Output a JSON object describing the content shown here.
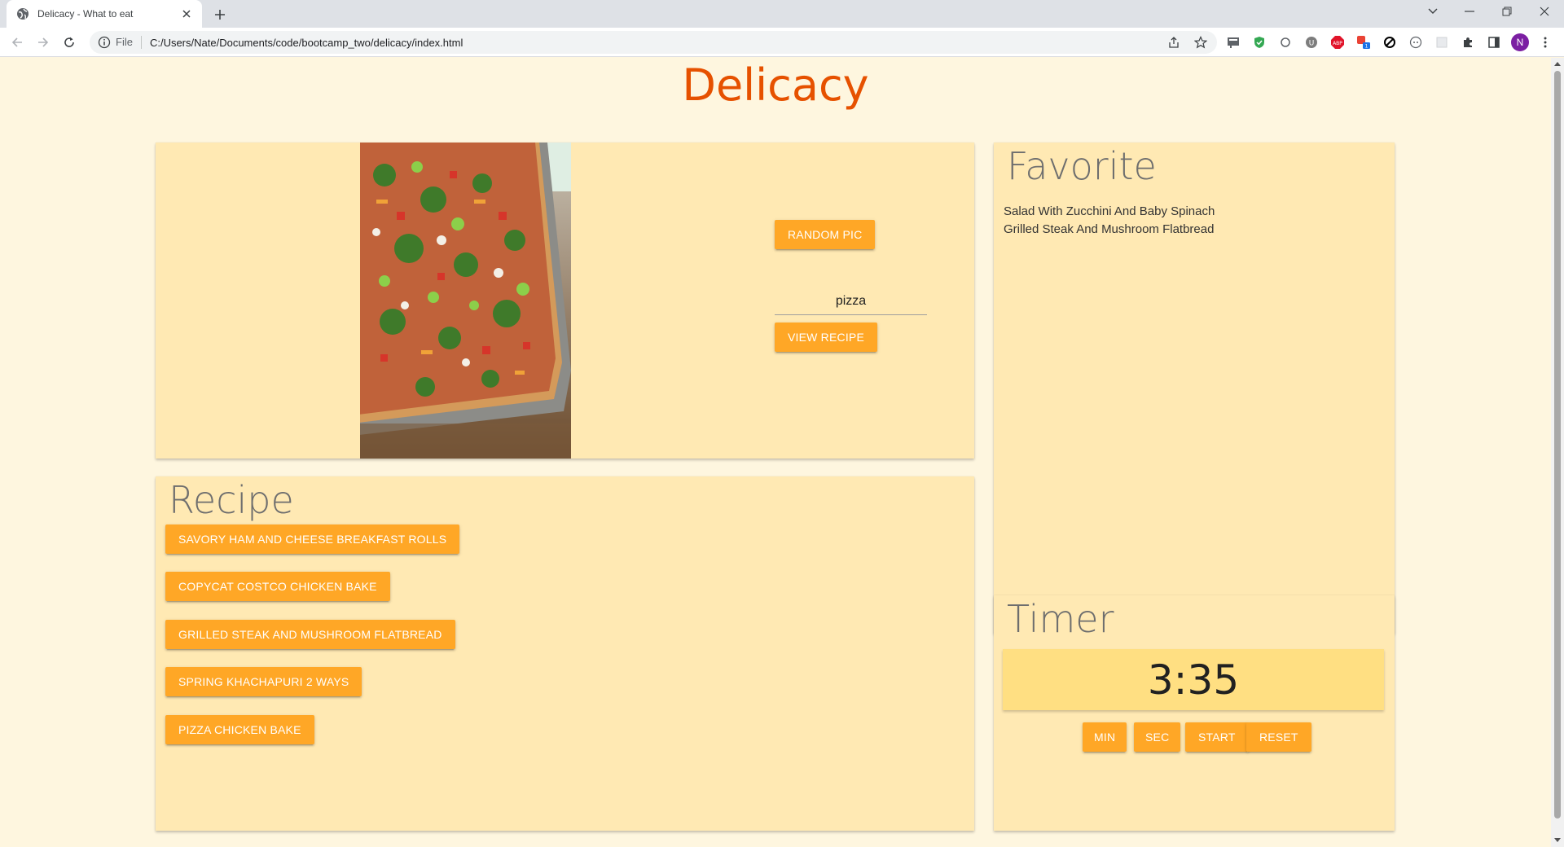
{
  "browser": {
    "tab_title": "Delicacy - What to eat",
    "url_scheme": "File",
    "url": "C:/Users/Nate/Documents/code/bootcamp_two/delicacy/index.html",
    "profile_initial": "N"
  },
  "page": {
    "title": "Delicacy"
  },
  "picker": {
    "random_pic_label": "RANDOM PIC",
    "search_value": "pizza",
    "view_recipe_label": "VIEW RECIPE"
  },
  "recipe": {
    "heading": "Recipe",
    "items": [
      "SAVORY HAM AND CHEESE BREAKFAST ROLLS",
      "COPYCAT COSTCO CHICKEN BAKE",
      "GRILLED STEAK AND MUSHROOM FLATBREAD",
      "SPRING KHACHAPURI 2 WAYS",
      "PIZZA CHICKEN BAKE"
    ]
  },
  "favorite": {
    "heading": "Favorite",
    "items": [
      "Salad With Zucchini And Baby Spinach",
      "Grilled Steak And Mushroom Flatbread"
    ]
  },
  "timer": {
    "heading": "Timer",
    "display": "3:35",
    "min_label": "MIN",
    "sec_label": "SEC",
    "start_label": "START",
    "reset_label": "RESET"
  },
  "colors": {
    "page_bg": "#fef6df",
    "card_bg": "#ffe9b3",
    "accent_button": "#ffa726",
    "title": "#e65100",
    "timer_bg": "#ffdf82"
  }
}
